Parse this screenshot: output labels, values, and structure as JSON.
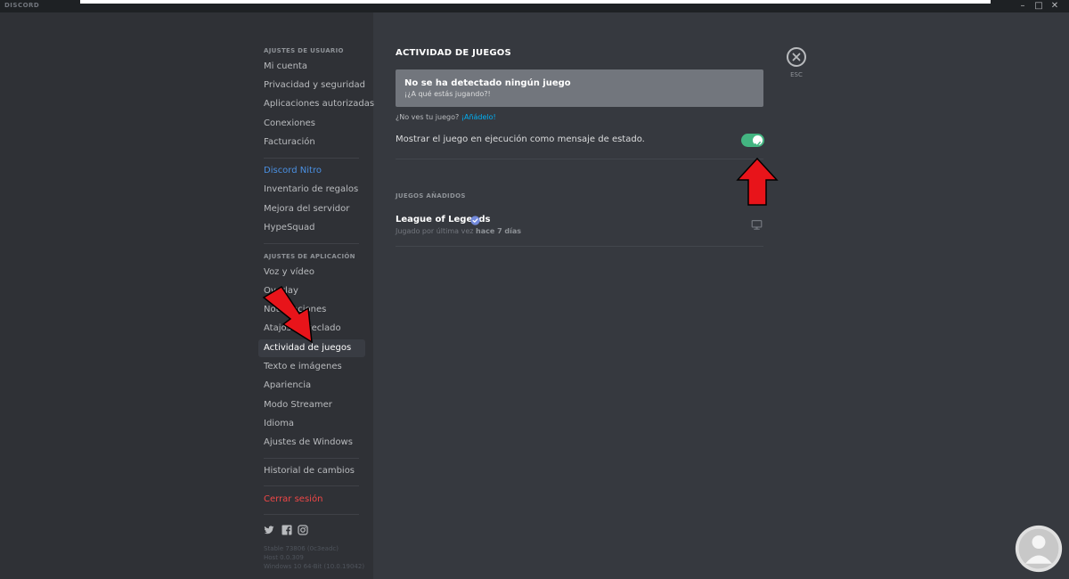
{
  "window": {
    "title": "DISCORD"
  },
  "sidebar": {
    "user_settings_header": "AJUSTES DE USUARIO",
    "user_items": [
      "Mi cuenta",
      "Privacidad y seguridad",
      "Aplicaciones autorizadas",
      "Conexiones",
      "Facturación"
    ],
    "billing_items": [
      "Discord Nitro",
      "Inventario de regalos",
      "Mejora del servidor",
      "HypeSquad"
    ],
    "app_settings_header": "AJUSTES DE APLICACIÓN",
    "app_items": [
      "Voz y vídeo",
      "Overlay",
      "Notificaciones",
      "Atajos de teclado",
      "Actividad de juegos",
      "Texto e imágenes",
      "Apariencia",
      "Modo Streamer",
      "Idioma",
      "Ajustes de Windows"
    ],
    "changelog": "Historial de cambios",
    "logout": "Cerrar sesión",
    "selected": "Actividad de juegos",
    "social_icons": [
      "twitter-icon",
      "facebook-icon",
      "instagram-icon"
    ],
    "version": [
      "Stable 73806 (0c3eadc)",
      "Host 0.0.309",
      "Windows 10 64-Bit (10.0.19042)"
    ]
  },
  "main": {
    "title": "ACTIVIDAD DE JUEGOS",
    "no_game_title": "No se ha detectado ningún juego",
    "no_game_subtitle": "¡¿A qué estás jugando?!",
    "help_prefix": "¿No ves tu juego?",
    "help_link": "¡Añádelo!",
    "status_toggle_label": "Mostrar el juego en ejecución como mensaje de estado.",
    "status_toggle_on": true,
    "added_games_header": "JUEGOS AÑADIDOS",
    "games": [
      {
        "name": "League of Legends",
        "meta_prefix": "Jugado por última vez",
        "meta_time": "hace 7 días"
      }
    ]
  },
  "close": {
    "label": "ESC"
  },
  "colors": {
    "accent_green": "#43b581",
    "link_blue": "#00b0f4",
    "nitro_blue": "#4a90e2",
    "danger_red": "#f04747",
    "arrow_red": "#e8141a"
  }
}
